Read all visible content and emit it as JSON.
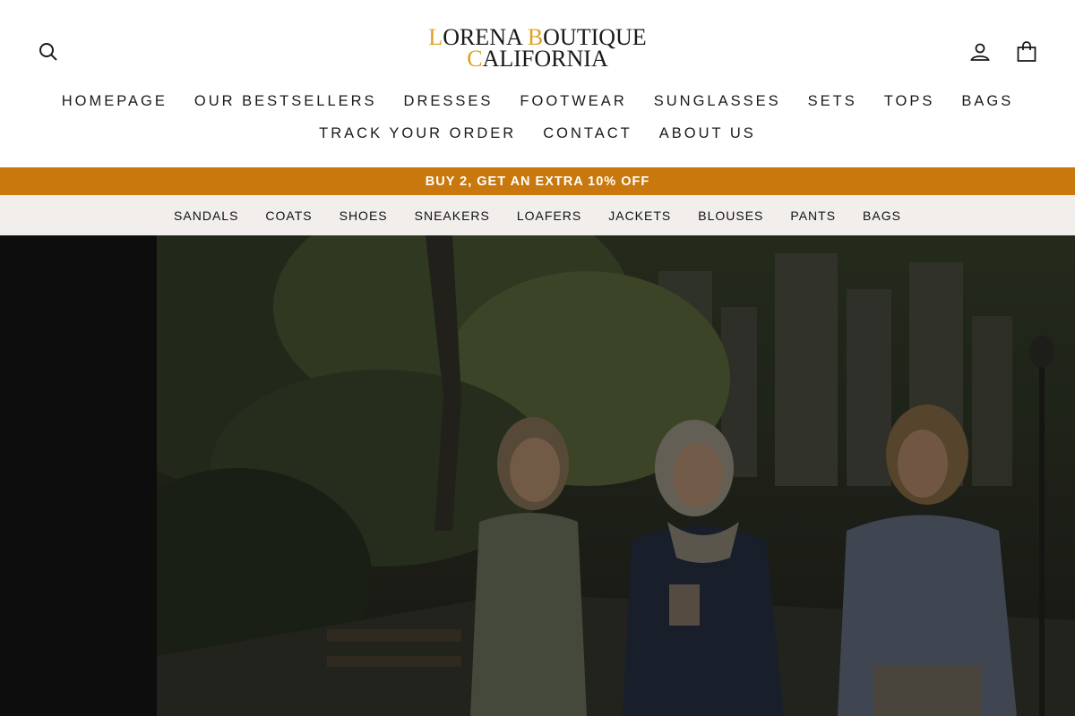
{
  "brand": {
    "line1_initial": "L",
    "line1_a": "ORENA ",
    "line1_initial2": "B",
    "line1_b": "OUTIQUE",
    "line2_initial": "C",
    "line2_rest": "ALIFORNIA"
  },
  "header": {
    "icons": [
      "search-icon",
      "account-icon",
      "cart-icon"
    ]
  },
  "main_nav": {
    "row1": [
      "HOMEPAGE",
      "OUR BESTSELLERS",
      "DRESSES",
      "FOOTWEAR",
      "SUNGLASSES",
      "SETS",
      "TOPS",
      "BAGS"
    ],
    "row2": [
      "TRACK YOUR ORDER",
      "CONTACT",
      "ABOUT US"
    ]
  },
  "promo": {
    "text": "BUY 2, GET AN EXTRA 10% OFF",
    "color": "#c8780c"
  },
  "sub_nav": {
    "items": [
      "SANDALS",
      "COATS",
      "SHOES",
      "SNEAKERS",
      "LOAFERS",
      "JACKETS",
      "BLOUSES",
      "PANTS",
      "BAGS"
    ],
    "background": "#f2eeec"
  },
  "colors": {
    "accent": "#e0a020",
    "hero_side": "#0d0d0d"
  }
}
